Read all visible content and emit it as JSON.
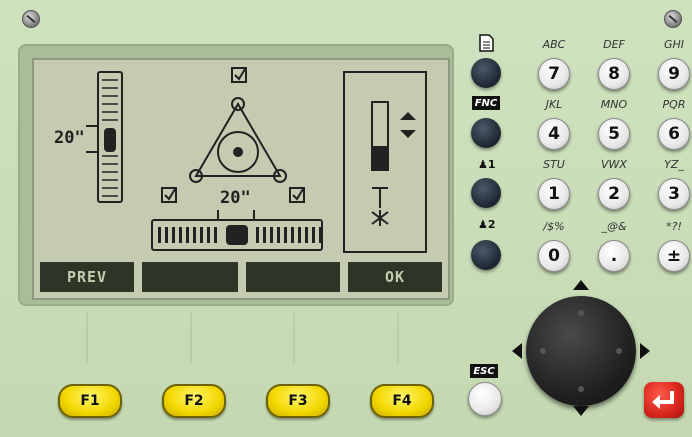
{
  "screen": {
    "left_level_value": "20\"",
    "bottom_level_value": "20\"",
    "softkeys": [
      "PREV",
      "",
      "",
      "OK"
    ]
  },
  "function_keys": [
    "F1",
    "F2",
    "F3",
    "F4"
  ],
  "side_keys": {
    "fnc_label": "FNC",
    "user1_label": "1",
    "user2_label": "2",
    "esc_label": "ESC"
  },
  "keypad": [
    {
      "letters": "ABC",
      "digit": "7"
    },
    {
      "letters": "DEF",
      "digit": "8"
    },
    {
      "letters": "GHI",
      "digit": "9"
    },
    {
      "letters": "JKL",
      "digit": "4"
    },
    {
      "letters": "MNO",
      "digit": "5"
    },
    {
      "letters": "PQR",
      "digit": "6"
    },
    {
      "letters": "STU",
      "digit": "1"
    },
    {
      "letters": "VWX",
      "digit": "2"
    },
    {
      "letters": "YZ_",
      "digit": "3"
    },
    {
      "letters": "/$%",
      "digit": "0"
    },
    {
      "letters": "_@&",
      "digit": "."
    },
    {
      "letters": "*?!",
      "digit": "±"
    }
  ]
}
